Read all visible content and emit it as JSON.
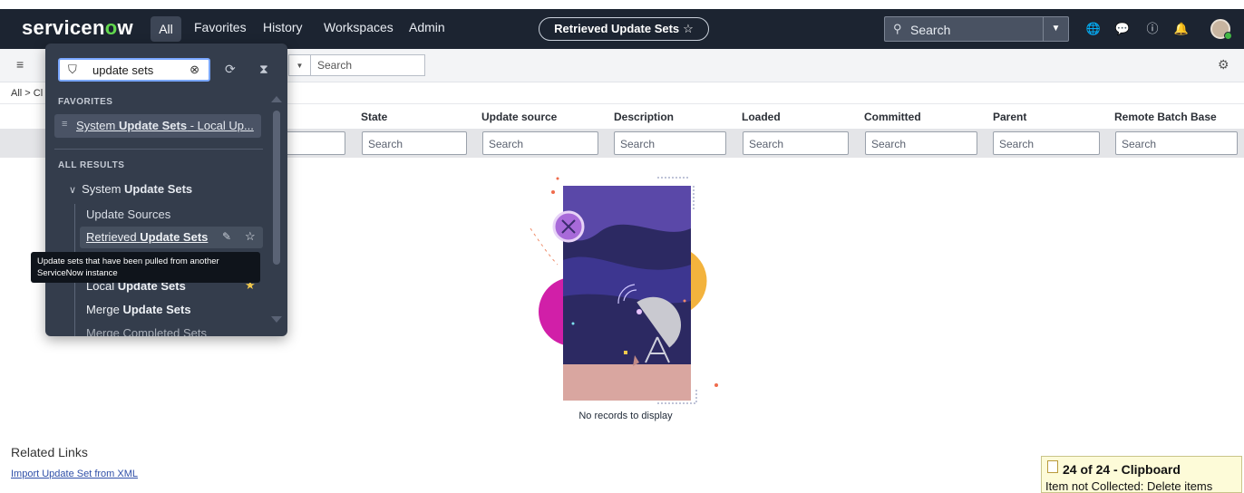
{
  "nav": {
    "logo_prefix": "servicen",
    "logo_o": "o",
    "logo_suffix": "w",
    "all": "All",
    "favorites": "Favorites",
    "history": "History",
    "workspaces": "Workspaces",
    "admin": "Admin",
    "context_pill": "Retrieved Update Sets",
    "search_placeholder": "Search"
  },
  "toolbar": {
    "search_placeholder": "Search",
    "breadcrumb": "All > Cl"
  },
  "table": {
    "columns": [
      "State",
      "Update source",
      "Description",
      "Loaded",
      "Committed",
      "Parent",
      "Remote Batch Base"
    ],
    "filter_placeholder": "Search",
    "empty_message": "No records to display"
  },
  "related": {
    "title": "Related Links",
    "import_link": "Import Update Set from XML"
  },
  "clipboard": {
    "title": "24 of 24 - Clipboard",
    "status": "Item not Collected: Delete items"
  },
  "menu": {
    "filter_value": "update sets",
    "favorites_heading": "FAVORITES",
    "favorite_prefix": "System ",
    "favorite_bold": "Update Sets",
    "favorite_suffix": " - Local Up...",
    "all_results_heading": "ALL RESULTS",
    "group_prefix": "System ",
    "group_bold": "Update Sets",
    "items": {
      "update_sources": "Update Sources",
      "retrieved_prefix": "Retrieved ",
      "retrieved_bold": "Update Sets",
      "local_prefix": "Local ",
      "local_bold": "Update Sets",
      "merge_prefix": "Merge ",
      "merge_bold": "Update Sets",
      "partial": "Merge Completed Sets"
    },
    "tooltip": "Update sets that have been pulled from another ServiceNow instance"
  },
  "colors": {
    "nav_bg": "#1c2431",
    "menu_bg": "#343d4c",
    "accent_green": "#62d84e",
    "link": "#2f4fa8",
    "favorite_star": "#f2c94c"
  }
}
